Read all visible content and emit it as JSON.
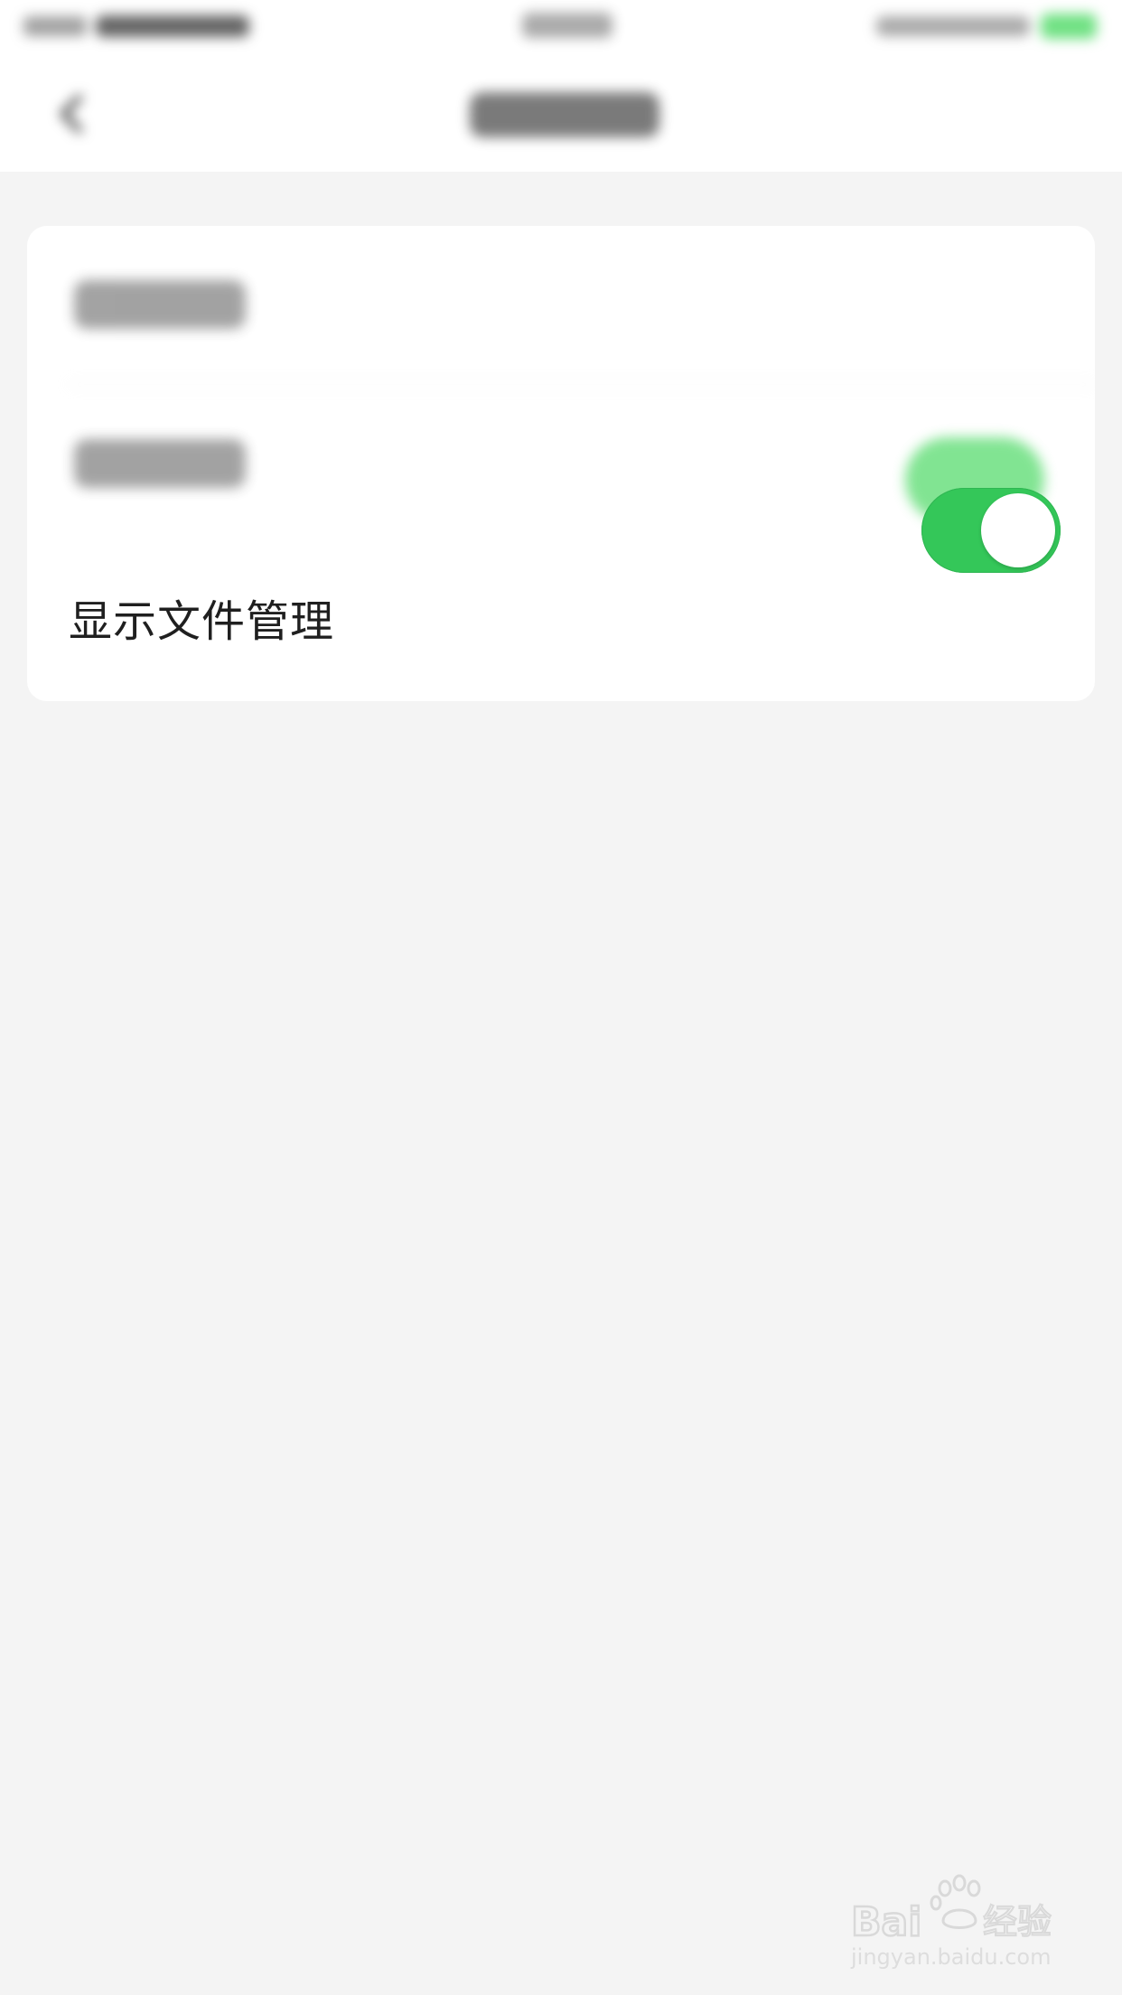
{
  "settings": {
    "rows": [
      {
        "label": "",
        "blurred": true
      },
      {
        "label": "",
        "blurred": true,
        "toggle_on": true
      },
      {
        "label": "显示文件管理",
        "blurred": false,
        "toggle_on": true
      }
    ]
  },
  "colors": {
    "background": "#f4f4f4",
    "card": "#ffffff",
    "toggle_on": "#34c759",
    "text": "#1f1f1f"
  },
  "icons": {
    "back": "chevron-left-icon",
    "watermark": "baidu-jingyan-logo"
  },
  "watermark": {
    "brand": "Bai 经验",
    "url": "jingyan.baidu.com"
  }
}
